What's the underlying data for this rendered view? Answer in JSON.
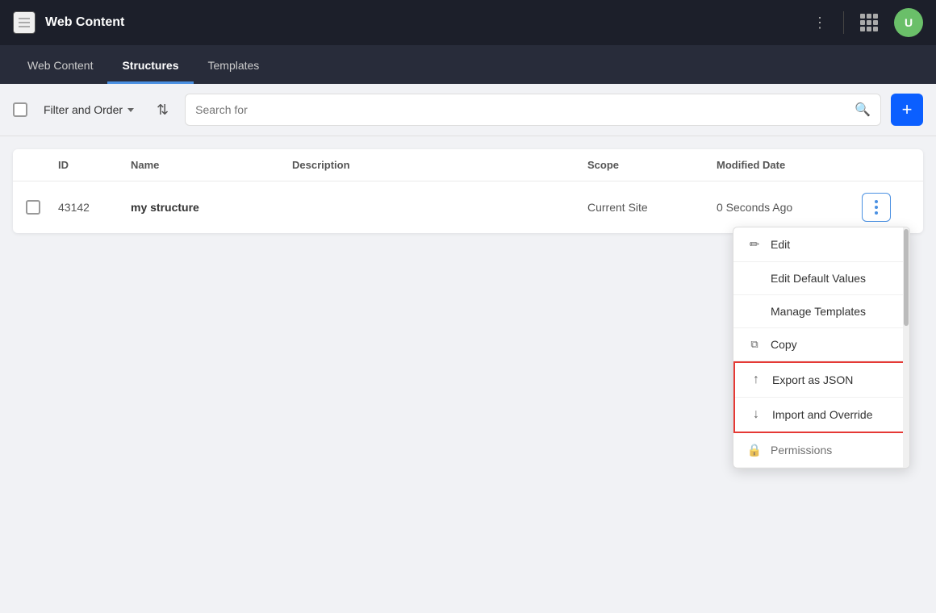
{
  "app": {
    "title": "Web Content",
    "avatar_initial": "U"
  },
  "nav": {
    "tabs": [
      {
        "id": "web-content",
        "label": "Web Content",
        "active": false
      },
      {
        "id": "structures",
        "label": "Structures",
        "active": true
      },
      {
        "id": "templates",
        "label": "Templates",
        "active": false
      }
    ]
  },
  "toolbar": {
    "filter_label": "Filter and Order",
    "search_placeholder": "Search for",
    "add_label": "+"
  },
  "table": {
    "headers": [
      "",
      "ID",
      "Name",
      "Description",
      "Scope",
      "Modified Date",
      ""
    ],
    "rows": [
      {
        "id": "43142",
        "name": "my structure",
        "description": "",
        "scope": "Current Site",
        "modified_date": "0 Seconds Ago"
      }
    ]
  },
  "context_menu": {
    "items": [
      {
        "id": "edit",
        "label": "Edit",
        "has_icon": true,
        "icon": "✏"
      },
      {
        "id": "edit-default-values",
        "label": "Edit Default Values",
        "has_icon": false
      },
      {
        "id": "manage-templates",
        "label": "Manage Templates",
        "has_icon": false
      },
      {
        "id": "copy",
        "label": "Copy",
        "has_icon": true,
        "icon": "⧉"
      },
      {
        "id": "export-json",
        "label": "Export as JSON",
        "has_icon": true,
        "icon": "↑",
        "highlighted": true
      },
      {
        "id": "import-override",
        "label": "Import and Override",
        "has_icon": true,
        "icon": "↓",
        "highlighted": true
      },
      {
        "id": "permissions",
        "label": "Permissions",
        "has_icon": true,
        "icon": "🔒",
        "partial": true
      }
    ]
  }
}
